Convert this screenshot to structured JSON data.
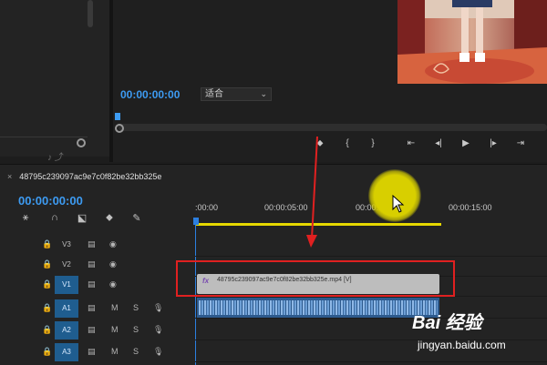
{
  "monitor": {
    "timecode": "00:00:00:00",
    "fit_label": "适合"
  },
  "timeline": {
    "tab_close": "×",
    "sequence_name": "48795c239097ac9e7c0f82be32bb325e",
    "timecode": "00:00:00:00",
    "ruler_ticks": [
      ":00:00",
      "00:00:05:00",
      "00:00:10:00",
      "00:00:15:00"
    ],
    "tracks": [
      {
        "label": "V3",
        "targeted": false
      },
      {
        "label": "V2",
        "targeted": false
      },
      {
        "label": "V1",
        "targeted": true
      },
      {
        "label": "A1",
        "targeted": true,
        "m": "M",
        "s": "S"
      },
      {
        "label": "A2",
        "targeted": true,
        "m": "M",
        "s": "S"
      },
      {
        "label": "A3",
        "targeted": true,
        "m": "M",
        "s": "S"
      }
    ],
    "video_clip": {
      "fx": "fx",
      "name": "48795c239097ac9e7c0f82be32bb325e.mp4 [V]"
    }
  },
  "watermark": {
    "logo": "Bai 经验",
    "url": "jingyan.baidu.com"
  },
  "colors": {
    "accent_timecode": "#3d9bf2",
    "work_area_bar": "#e6d800",
    "highlight": "#e02020",
    "track_target": "#1f5d8f"
  }
}
